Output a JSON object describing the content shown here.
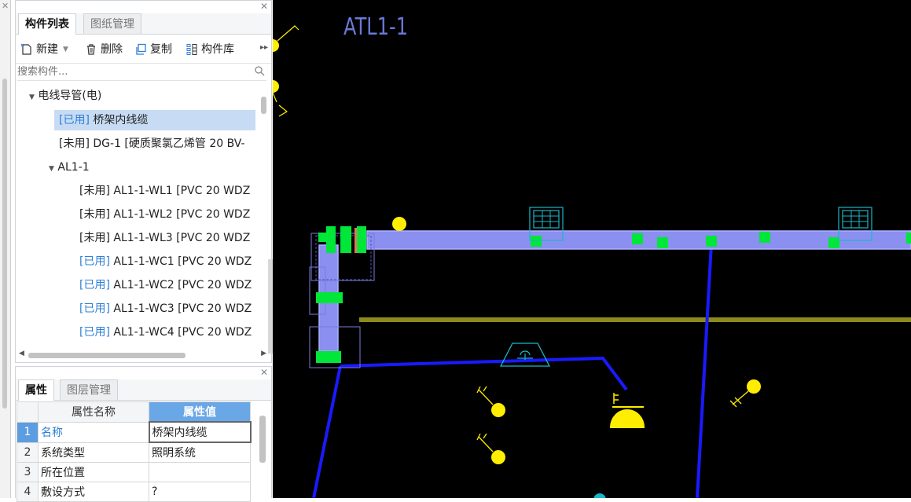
{
  "component_panel": {
    "tabs": [
      {
        "label": "构件列表",
        "active": true
      },
      {
        "label": "图纸管理",
        "active": false
      }
    ],
    "toolbar": {
      "new_label": "新建",
      "delete_label": "删除",
      "copy_label": "复制",
      "library_label": "构件库"
    },
    "search_placeholder": "搜索构件...",
    "tree": [
      {
        "text": "电线导管(电)",
        "level": 0,
        "expanded": true
      },
      {
        "tag": "[已用]",
        "text": " 桥架内线缆",
        "used": true,
        "selected": true
      },
      {
        "tag": "[未用]",
        "text": " DG-1 [硬质聚氯乙烯管 20 BV-",
        "used": false
      },
      {
        "text": "AL1-1",
        "level": 1,
        "expanded": true
      },
      {
        "tag": "[未用]",
        "text": " AL1-1-WL1 [PVC 20 WDZ",
        "used": false
      },
      {
        "tag": "[未用]",
        "text": " AL1-1-WL2 [PVC 20 WDZ",
        "used": false
      },
      {
        "tag": "[未用]",
        "text": " AL1-1-WL3 [PVC 20 WDZ",
        "used": false
      },
      {
        "tag": "[已用]",
        "text": " AL1-1-WC1 [PVC 20 WDZ",
        "used": true
      },
      {
        "tag": "[已用]",
        "text": " AL1-1-WC2 [PVC 20 WDZ",
        "used": true
      },
      {
        "tag": "[已用]",
        "text": " AL1-1-WC3 [PVC 20 WDZ",
        "used": true
      },
      {
        "tag": "[已用]",
        "text": " AL1-1-WC4 [PVC 20 WDZ",
        "used": true
      }
    ]
  },
  "property_panel": {
    "tabs": [
      {
        "label": "属性",
        "active": true
      },
      {
        "label": "图层管理",
        "active": false
      }
    ],
    "header_name": "属性名称",
    "header_value": "属性值",
    "rows": [
      {
        "num": "1",
        "name": "名称",
        "value": "桥架内线缆",
        "selected": true
      },
      {
        "num": "2",
        "name": "系统类型",
        "value": "照明系统"
      },
      {
        "num": "3",
        "name": "所在位置",
        "value": ""
      },
      {
        "num": "4",
        "name": "敷设方式",
        "value": "?"
      }
    ]
  },
  "canvas": {
    "label": "ATL1-1",
    "colors": {
      "background": "#000000",
      "tray": "#8a8ff0",
      "wire": "#1a1aff",
      "marker": "#00e639",
      "olive_line": "#8c8a1c",
      "cyan_symbol": "#19b8c8",
      "yellow": "#ffee00"
    }
  }
}
